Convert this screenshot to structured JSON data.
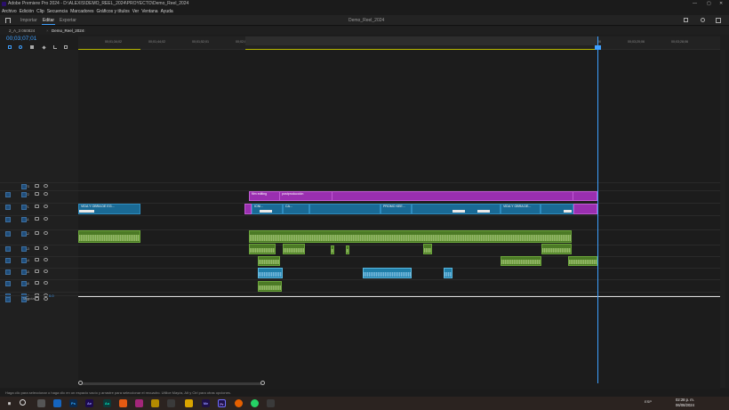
{
  "window": {
    "title": "Adobe Premiere Pro 2024 - D:\\ALEXIS\\DEMO_REEL_2024\\PROYECTO\\Demo_Reel_2024",
    "controls": [
      "—",
      "▢",
      "✕"
    ]
  },
  "menu": [
    "Archivo",
    "Edición",
    "Clip",
    "Secuencia",
    "Marcadores",
    "Gráficos y títulos",
    "Ver",
    "Ventana",
    "Ayuda"
  ],
  "workspace": {
    "tabs": [
      {
        "label": "Importar"
      },
      {
        "label": "Editar"
      },
      {
        "label": "Exportar"
      }
    ],
    "project_title": "Demo_Reel_2024"
  },
  "sequence_tabs": [
    {
      "label": "2_A_3 060824"
    },
    {
      "label": "Demo_Reel_2024"
    }
  ],
  "timeline": {
    "timecode": "00;03;07;01",
    "ruler_ticks": [
      "00;01;34;02",
      "00;01;44;02",
      "00;01;52;01",
      "00;02;00;16",
      "00;02;16;03",
      "00;02;24;04",
      "00;02;32;04",
      "00;02;40;04",
      "00;02;48;04",
      "00;02;56;04",
      "00;03;04;04",
      "00;03;12;06",
      "00;03;20;06",
      "00;03;28;06"
    ],
    "tracks": [
      {
        "name": "V3"
      },
      {
        "name": "V2"
      },
      {
        "name": "V1"
      },
      {
        "name": "A1"
      },
      {
        "name": "A2"
      },
      {
        "name": "A3"
      },
      {
        "name": "A4"
      },
      {
        "name": "A5"
      },
      {
        "name": "A6"
      },
      {
        "name": "A7"
      },
      {
        "name": "A8"
      }
    ],
    "mix": {
      "label": "Mezcla",
      "value": "0.0"
    },
    "clip_labels": {
      "v3_a": "film editing",
      "v3_b": "postproducción",
      "v2_a": "VIDA Y OBRA DE EG...",
      "v2_b": "ICNI...",
      "v2_c": "CA...",
      "v2_d": "PROMO KEE...",
      "v2_e": "VIDA Y OBRA DE..."
    }
  },
  "status": {
    "hint": "Haga clic para seleccionar o haga clic en un espacio vacío y arrastre para seleccionar el recuadro. Utilice Mayús, Alt y Ctrl para otras opciones."
  },
  "taskbar": {
    "lang": "ESP",
    "time": "02:28 p. m.",
    "date": "06/08/2024",
    "apps": [
      "Ps",
      "Ae",
      "Au",
      "Me",
      "Pr"
    ]
  },
  "colors": {
    "accent": "#3ea0ff",
    "purple_clip": "#9a2fb0",
    "blue_clip": "#1a6a95",
    "green_clip": "#4c7a26"
  }
}
